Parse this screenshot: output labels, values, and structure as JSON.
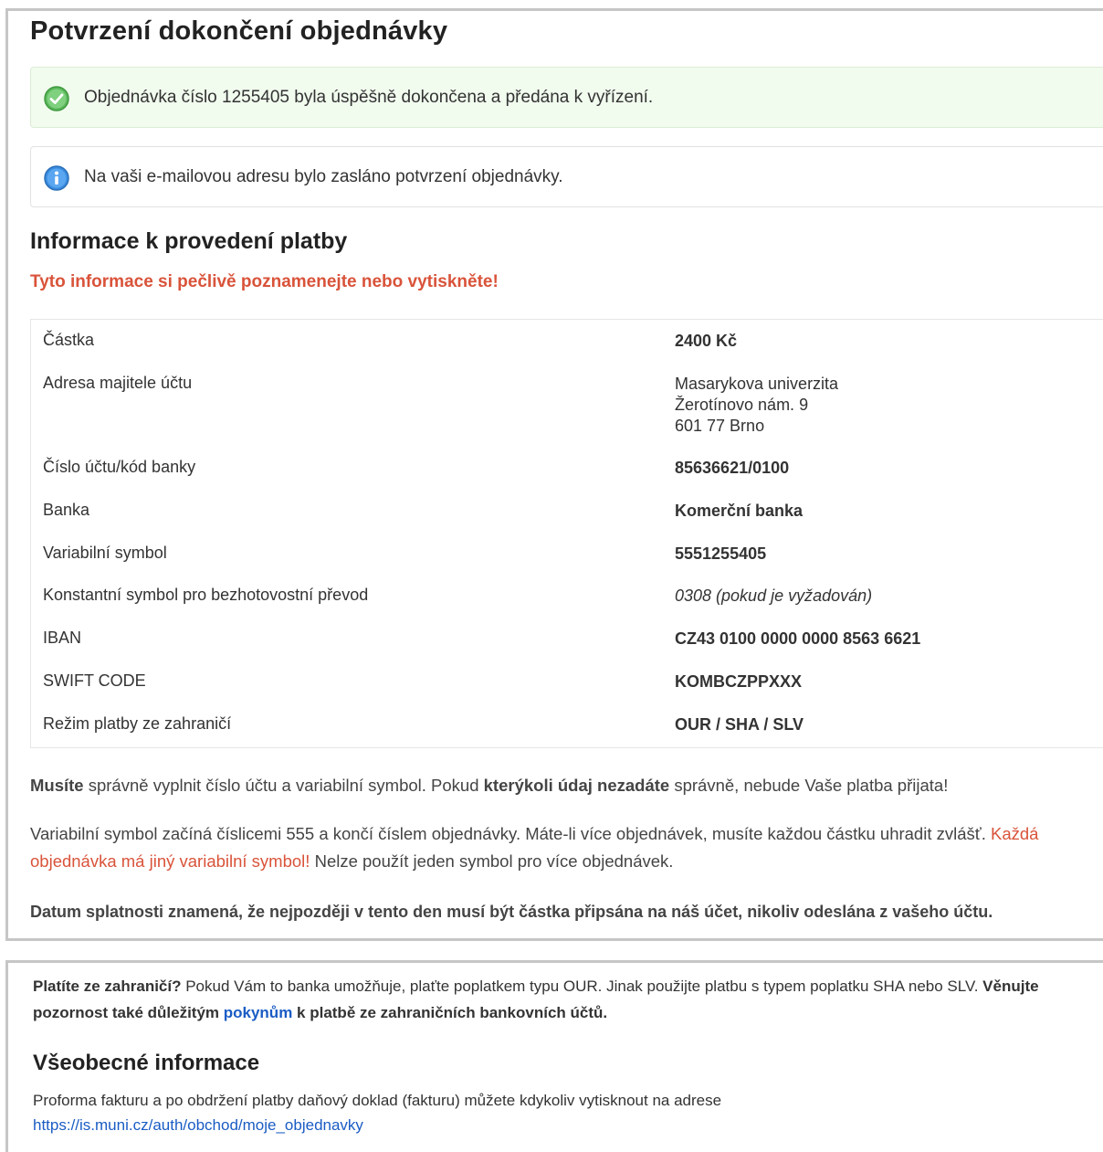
{
  "page_title": "Potvrzení dokončení objednávky",
  "alerts": {
    "success": "Objednávka číslo 1255405 byla úspěšně dokončena a předána k vyřízení.",
    "info": "Na vaši e-mailovou adresu bylo zasláno potvrzení objednávky."
  },
  "payment": {
    "heading": "Informace k provedení platby",
    "notice": "Tyto informace si pečlivě poznamenejte nebo vytiskněte!",
    "rows": [
      {
        "label": "Částka",
        "value": "2400 Kč"
      },
      {
        "label": "Adresa majitele účtu",
        "value_lines": [
          "Masarykova univerzita",
          "Žerotínovo nám. 9",
          "601 77  Brno"
        ]
      },
      {
        "label": "Číslo účtu/kód banky",
        "value": "85636621/0100"
      },
      {
        "label": "Banka",
        "value": "Komerční banka"
      },
      {
        "label": "Variabilní symbol",
        "value": "5551255405"
      },
      {
        "label": "Konstantní symbol pro bezhotovostní převod",
        "value": "0308 (pokud je vyžadován)"
      },
      {
        "label": "IBAN",
        "value": "CZ43 0100 0000 0000 8563 6621"
      },
      {
        "label": "SWIFT CODE",
        "value": "KOMBCZPPXXX"
      },
      {
        "label": "Režim platby ze zahraničí",
        "value": "OUR / SHA / SLV"
      }
    ]
  },
  "warning1": {
    "a": "Musíte",
    "b": " správně vyplnit číslo účtu a variabilní symbol. Pokud ",
    "c": "kterýkoli údaj nezadáte",
    "d": " správně, nebude Vaše platba přijata!"
  },
  "vs_info": {
    "line1a": "Variabilní symbol začíná číslicemi 555 a končí číslem objednávky. Máte-li více objednávek, musíte každou částku uhradit zvlášť. ",
    "line1b": "Každá",
    "line2a": "objednávka má jiný variabilní symbol!",
    "line2b": " Nelze použít jeden symbol pro více objednávek."
  },
  "due_notice": "Datum splatnosti znamená, že nejpozději v tento den musí být částka připsána na náš účet, nikoliv odeslána z vašeho účtu.",
  "foreign": {
    "q": "Platíte ze zahraničí?",
    "t1": " Pokud Vám to banka umožňuje, plaťte poplatkem typu OUR. Jinak použijte platbu s typem poplatku SHA nebo SLV. ",
    "b1": "Věnujte",
    "b2": "pozornost také důležitým ",
    "link": "pokynům",
    "b3": " k platbě ze zahraničních bankovních účtů."
  },
  "general": {
    "heading": "Všeobecné informace",
    "text": "Proforma fakturu a po obdržení platby daňový doklad (fakturu) můžete kdykoliv vytisknout na adrese",
    "url": "https://is.muni.cz/auth/obchod/moje_objednavky"
  },
  "colors": {
    "accent_red": "#d9533a",
    "link_blue": "#1a5cc4",
    "success_bg": "#f1fbee"
  }
}
